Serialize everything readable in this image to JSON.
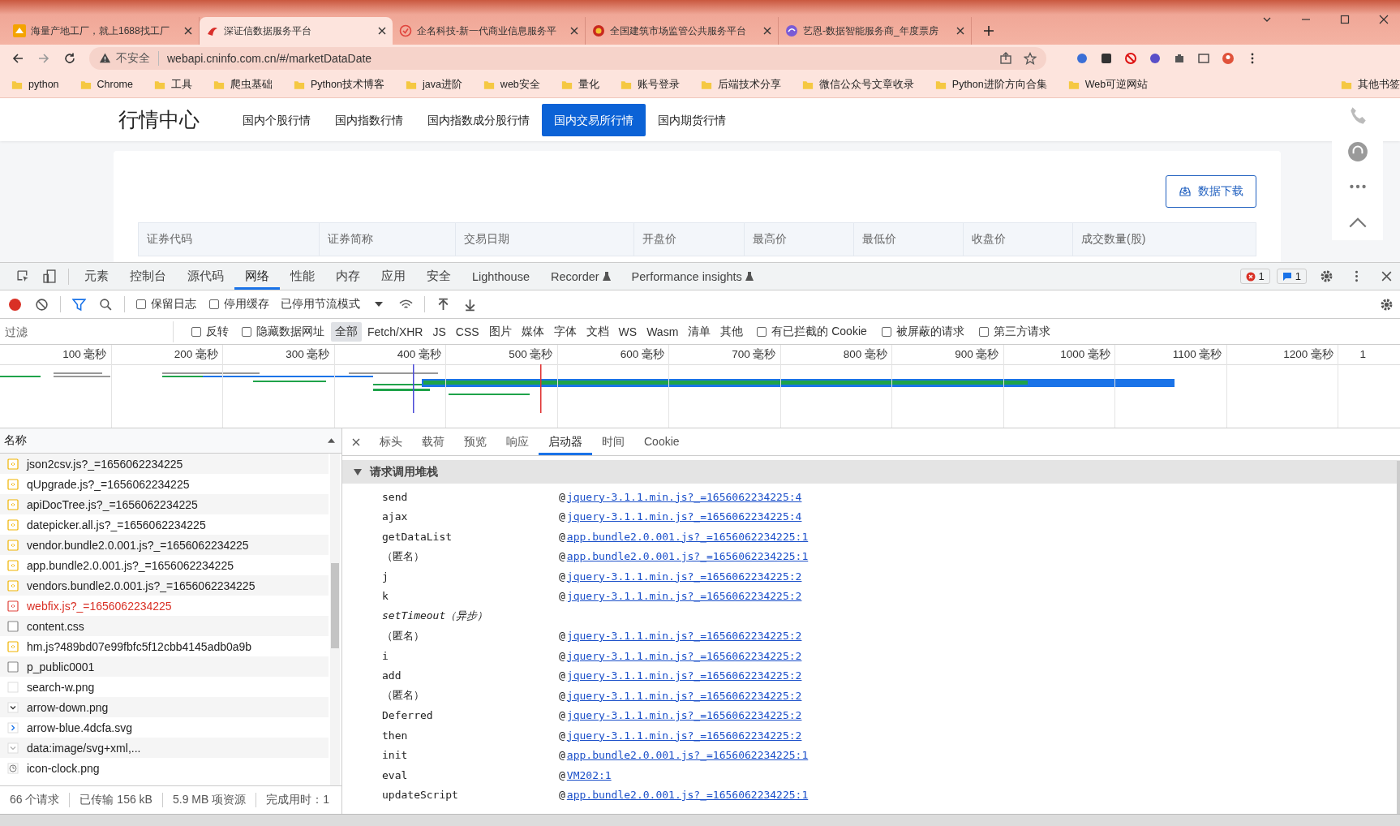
{
  "browser_tabs": [
    {
      "title": "海量产地工厂，就上1688找工厂",
      "selected": false,
      "kind": "deal"
    },
    {
      "title": "深证信数据服务平台",
      "selected": true,
      "kind": "brand"
    },
    {
      "title": "企名科技-新一代商业信息服务平",
      "selected": false,
      "kind": "ring"
    },
    {
      "title": "全国建筑市场监管公共服务平台",
      "selected": false,
      "kind": "emblem"
    },
    {
      "title": "艺恩-数据智能服务商_年度票房",
      "selected": false,
      "kind": "swirl"
    }
  ],
  "address": {
    "security": "不安全",
    "url": "webapi.cninfo.com.cn/#/marketDataDate"
  },
  "bookmarks": [
    "python",
    "Chrome",
    "工具",
    "爬虫基础",
    "Python技术博客",
    "java进阶",
    "web安全",
    "量化",
    "账号登录",
    "后端技术分享",
    "微信公众号文章收录",
    "Python进阶方向合集",
    "Web可逆网站"
  ],
  "other_bookmarks": "其他书签",
  "page": {
    "logo": "行情中心",
    "nav": [
      {
        "label": "国内个股行情",
        "selected": false
      },
      {
        "label": "国内指数行情",
        "selected": false
      },
      {
        "label": "国内指数成分股行情",
        "selected": false
      },
      {
        "label": "国内交易所行情",
        "selected": true
      },
      {
        "label": "国内期货行情",
        "selected": false
      }
    ],
    "download_button": "数据下载",
    "table_columns": [
      "证券代码",
      "证券简称",
      "交易日期",
      "开盘价",
      "最高价",
      "最低价",
      "收盘价",
      "成交数量(股)"
    ]
  },
  "devtools": {
    "tabs": [
      {
        "label": "元素",
        "selected": false,
        "experimental": false
      },
      {
        "label": "控制台",
        "selected": false,
        "experimental": false
      },
      {
        "label": "源代码",
        "selected": false,
        "experimental": false
      },
      {
        "label": "网络",
        "selected": true,
        "experimental": false
      },
      {
        "label": "性能",
        "selected": false,
        "experimental": false
      },
      {
        "label": "内存",
        "selected": false,
        "experimental": false
      },
      {
        "label": "应用",
        "selected": false,
        "experimental": false
      },
      {
        "label": "安全",
        "selected": false,
        "experimental": false
      },
      {
        "label": "Lighthouse",
        "selected": false,
        "experimental": false
      },
      {
        "label": "Recorder",
        "selected": false,
        "experimental": true
      },
      {
        "label": "Performance insights",
        "selected": false,
        "experimental": true
      }
    ],
    "error_count": "1",
    "message_count": "1"
  },
  "network_toolbar": {
    "recording": true,
    "checkboxes": [
      {
        "label": "保留日志",
        "checked": false
      },
      {
        "label": "停用缓存",
        "checked": false
      }
    ],
    "throttling": "已停用节流模式"
  },
  "filter": {
    "placeholder": "过滤",
    "checkboxes": [
      {
        "label": "反转",
        "checked": false
      },
      {
        "label": "隐藏数据网址",
        "checked": false
      }
    ],
    "types": [
      {
        "label": "全部",
        "selected": true
      },
      {
        "label": "Fetch/XHR",
        "selected": false
      },
      {
        "label": "JS",
        "selected": false
      },
      {
        "label": "CSS",
        "selected": false
      },
      {
        "label": "图片",
        "selected": false
      },
      {
        "label": "媒体",
        "selected": false
      },
      {
        "label": "字体",
        "selected": false
      },
      {
        "label": "文档",
        "selected": false
      },
      {
        "label": "WS",
        "selected": false
      },
      {
        "label": "Wasm",
        "selected": false
      },
      {
        "label": "清单",
        "selected": false
      },
      {
        "label": "其他",
        "selected": false
      }
    ],
    "options": [
      {
        "label": "有已拦截的 Cookie",
        "checked": false
      },
      {
        "label": "被屏蔽的请求",
        "checked": false
      },
      {
        "label": "第三方请求",
        "checked": false
      }
    ]
  },
  "timeline_ticks": [
    "100 毫秒",
    "200 毫秒",
    "300 毫秒",
    "400 毫秒",
    "500 毫秒",
    "600 毫秒",
    "700 毫秒",
    "800 毫秒",
    "900 毫秒",
    "1000 毫秒",
    "1100 毫秒",
    "1200 毫秒",
    "1"
  ],
  "requests": {
    "header": "名称",
    "items": [
      {
        "name": "json2csv.js?_=1656062234225",
        "kind": "script"
      },
      {
        "name": "qUpgrade.js?_=1656062234225",
        "kind": "script"
      },
      {
        "name": "apiDocTree.js?_=1656062234225",
        "kind": "script"
      },
      {
        "name": "datepicker.all.js?_=1656062234225",
        "kind": "script"
      },
      {
        "name": "vendor.bundle2.0.001.js?_=1656062234225",
        "kind": "script"
      },
      {
        "name": "app.bundle2.0.001.js?_=1656062234225",
        "kind": "script"
      },
      {
        "name": "vendors.bundle2.0.001.js?_=1656062234225",
        "kind": "script"
      },
      {
        "name": "webfix.js?_=1656062234225",
        "kind": "failed"
      },
      {
        "name": "content.css",
        "kind": "file"
      },
      {
        "name": "hm.js?489bd07e99fbfc5f12cbb4145adb0a9b",
        "kind": "script"
      },
      {
        "name": "p_public0001",
        "kind": "file"
      },
      {
        "name": "search-w.png",
        "kind": "blank"
      },
      {
        "name": "arrow-down.png",
        "kind": "chevron-down"
      },
      {
        "name": "arrow-blue.4dcfa.svg",
        "kind": "chevron-right"
      },
      {
        "name": "data:image/svg+xml,...",
        "kind": "data"
      },
      {
        "name": "icon-clock.png",
        "kind": "clock"
      }
    ],
    "status": [
      "66 个请求",
      "已传输 156 kB",
      "5.9 MB 项资源",
      "完成用时：1"
    ]
  },
  "details": {
    "tabs": [
      {
        "label": "标头",
        "selected": false
      },
      {
        "label": "载荷",
        "selected": false
      },
      {
        "label": "预览",
        "selected": false
      },
      {
        "label": "响应",
        "selected": false
      },
      {
        "label": "启动器",
        "selected": true
      },
      {
        "label": "时间",
        "selected": false
      },
      {
        "label": "Cookie",
        "selected": false
      }
    ],
    "section": {
      "title": "请求调用堆栈",
      "expanded": true
    },
    "frame_at": "@",
    "frames": [
      {
        "function": "send",
        "kind": "frame",
        "source": "jquery-3.1.1.min.js?_=1656062234225:4"
      },
      {
        "function": "ajax",
        "kind": "frame",
        "source": "jquery-3.1.1.min.js?_=1656062234225:4"
      },
      {
        "function": "getDataList",
        "kind": "frame",
        "source": "app.bundle2.0.001.js?_=1656062234225:1"
      },
      {
        "function": "（匿名）",
        "kind": "frame",
        "source": "app.bundle2.0.001.js?_=1656062234225:1"
      },
      {
        "function": "j",
        "kind": "frame",
        "source": "jquery-3.1.1.min.js?_=1656062234225:2"
      },
      {
        "function": "k",
        "kind": "frame",
        "source": "jquery-3.1.1.min.js?_=1656062234225:2"
      },
      {
        "function": "setTimeout（异步）",
        "kind": "async"
      },
      {
        "function": "（匿名）",
        "kind": "frame",
        "source": "jquery-3.1.1.min.js?_=1656062234225:2"
      },
      {
        "function": "i",
        "kind": "frame",
        "source": "jquery-3.1.1.min.js?_=1656062234225:2"
      },
      {
        "function": "add",
        "kind": "frame",
        "source": "jquery-3.1.1.min.js?_=1656062234225:2"
      },
      {
        "function": "（匿名）",
        "kind": "frame",
        "source": "jquery-3.1.1.min.js?_=1656062234225:2"
      },
      {
        "function": "Deferred",
        "kind": "frame",
        "source": "jquery-3.1.1.min.js?_=1656062234225:2"
      },
      {
        "function": "then",
        "kind": "frame",
        "source": "jquery-3.1.1.min.js?_=1656062234225:2"
      },
      {
        "function": "init",
        "kind": "frame",
        "source": "app.bundle2.0.001.js?_=1656062234225:1"
      },
      {
        "function": "eval",
        "kind": "frame",
        "source": "VM202:1"
      },
      {
        "function": "updateScript",
        "kind": "frame",
        "source": "app.bundle2.0.001.js?_=1656062234225:1"
      }
    ]
  }
}
